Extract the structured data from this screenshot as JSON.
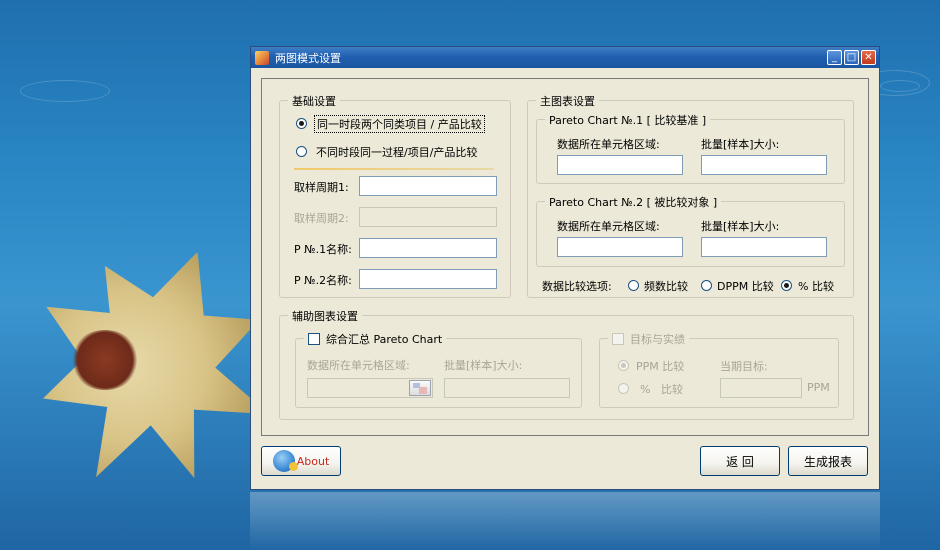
{
  "window": {
    "title": "两图模式设置",
    "buttons": {
      "minimize": "_",
      "maximize": "□",
      "close": "✕"
    }
  },
  "basic": {
    "legend": "基础设置",
    "option1": "同一时段两个同类项目 / 产品比较",
    "option2": "不同时段同一过程/项目/产品比较",
    "period1_label": "取样周期1:",
    "period2_label": "取样周期2:",
    "p1_name_label": "P №.1名称:",
    "p2_name_label": "P №.2名称:",
    "period1_value": "",
    "period2_value": "",
    "p1_name_value": "",
    "p2_name_value": "",
    "selected_option": "option1"
  },
  "main_chart": {
    "legend": "主图表设置",
    "chart1": {
      "legend": "Pareto Chart №.1 [ 比较基准 ]",
      "range_label": "数据所在单元格区域:",
      "batch_label": "批量[样本]大小:",
      "range_value": "",
      "batch_value": ""
    },
    "chart2": {
      "legend": "Pareto Chart №.2 [ 被比较对象 ]",
      "range_label": "数据所在单元格区域:",
      "batch_label": "批量[样本]大小:",
      "range_value": "",
      "batch_value": ""
    },
    "compare_label": "数据比较选项:",
    "compare_options": [
      "频数比较",
      "DPPM 比较",
      "% 比较"
    ],
    "compare_selected": "% 比较"
  },
  "aux_chart": {
    "legend": "辅助图表设置",
    "summary": {
      "checkbox_label": "综合汇总 Pareto Chart",
      "range_label": "数据所在单元格区域:",
      "batch_label": "批量[样本]大小:"
    },
    "target": {
      "checkbox_label": "目标与实绩",
      "ppm_label": "PPM 比较",
      "pct_label": "%   比较",
      "current_target_label": "当期目标:",
      "unit": "PPM"
    }
  },
  "footer": {
    "about_label": "About",
    "back_label": "返 回",
    "generate_label": "生成报表"
  },
  "colors": {
    "titlebar": "#2160b0",
    "dialog_bg": "#ece9d8",
    "about_text": "#c8281e"
  }
}
